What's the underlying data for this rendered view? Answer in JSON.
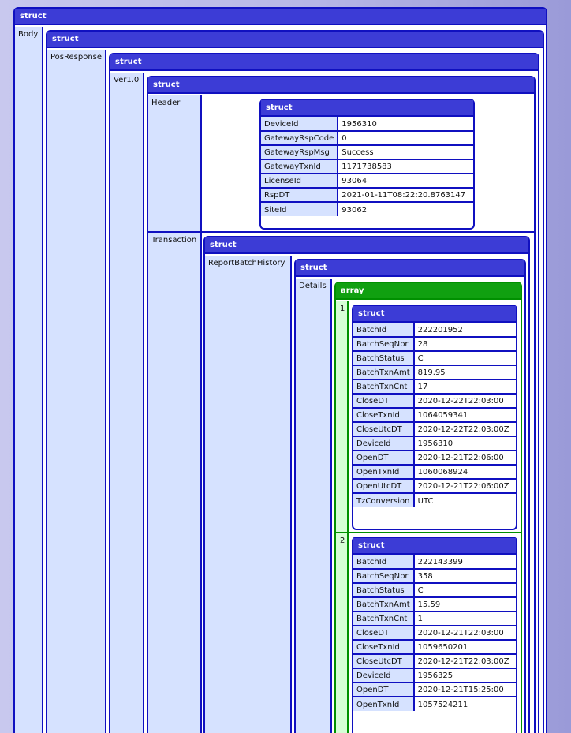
{
  "labels": {
    "struct": "struct",
    "array": "array",
    "body": "Body",
    "pos_response": "PosResponse",
    "ver": "Ver1.0",
    "header": "Header",
    "transaction": "Transaction",
    "report_batch_history": "ReportBatchHistory",
    "details": "Details"
  },
  "header": {
    "rows": [
      {
        "k": "DeviceId",
        "v": "1956310"
      },
      {
        "k": "GatewayRspCode",
        "v": "0"
      },
      {
        "k": "GatewayRspMsg",
        "v": "Success"
      },
      {
        "k": "GatewayTxnId",
        "v": "1171738583"
      },
      {
        "k": "LicenseId",
        "v": "93064"
      },
      {
        "k": "RspDT",
        "v": "2021-01-11T08:22:20.8763147"
      },
      {
        "k": "SiteId",
        "v": "93062"
      }
    ]
  },
  "details": [
    {
      "index": "1",
      "rows": [
        {
          "k": "BatchId",
          "v": "222201952"
        },
        {
          "k": "BatchSeqNbr",
          "v": "28"
        },
        {
          "k": "BatchStatus",
          "v": "C"
        },
        {
          "k": "BatchTxnAmt",
          "v": "819.95"
        },
        {
          "k": "BatchTxnCnt",
          "v": "17"
        },
        {
          "k": "CloseDT",
          "v": "2020-12-22T22:03:00"
        },
        {
          "k": "CloseTxnId",
          "v": "1064059341"
        },
        {
          "k": "CloseUtcDT",
          "v": "2020-12-22T22:03:00Z"
        },
        {
          "k": "DeviceId",
          "v": "1956310"
        },
        {
          "k": "OpenDT",
          "v": "2020-12-21T22:06:00"
        },
        {
          "k": "OpenTxnId",
          "v": "1060068924"
        },
        {
          "k": "OpenUtcDT",
          "v": "2020-12-21T22:06:00Z"
        },
        {
          "k": "TzConversion",
          "v": "UTC"
        }
      ]
    },
    {
      "index": "2",
      "rows": [
        {
          "k": "BatchId",
          "v": "222143399"
        },
        {
          "k": "BatchSeqNbr",
          "v": "358"
        },
        {
          "k": "BatchStatus",
          "v": "C"
        },
        {
          "k": "BatchTxnAmt",
          "v": "15.59"
        },
        {
          "k": "BatchTxnCnt",
          "v": "1"
        },
        {
          "k": "CloseDT",
          "v": "2020-12-21T22:03:00"
        },
        {
          "k": "CloseTxnId",
          "v": "1059650201"
        },
        {
          "k": "CloseUtcDT",
          "v": "2020-12-21T22:03:00Z"
        },
        {
          "k": "DeviceId",
          "v": "1956325"
        },
        {
          "k": "OpenDT",
          "v": "2020-12-21T15:25:00"
        },
        {
          "k": "OpenTxnId",
          "v": "1057524211"
        }
      ]
    }
  ]
}
